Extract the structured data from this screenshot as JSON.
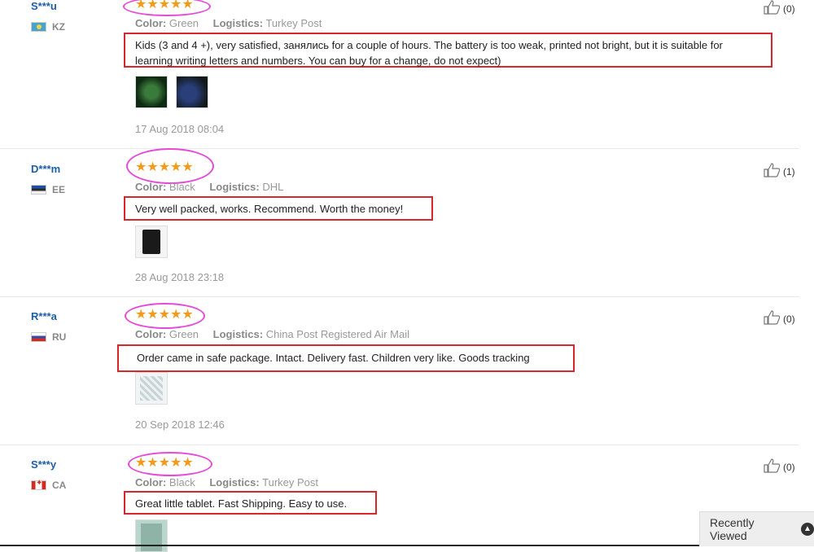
{
  "reviews": [
    {
      "user": "S***u",
      "country": "KZ",
      "flag": "kz-flag",
      "stars": "★★★★★",
      "color_label": "Color:",
      "color": "Green",
      "logistics_label": "Logistics:",
      "logistics": "Turkey Post",
      "comment": "Kids (3 and 4 +), very satisfied, занялись for a couple of hours. The battery is too weak, printed not bright, but it is suitable for learning writing letters and numbers. You can buy for a change, do not expect)",
      "date": "17 Aug 2018 08:04",
      "likes": "(0)"
    },
    {
      "user": "D***m",
      "country": "EE",
      "flag": "ee-flag",
      "stars": "★★★★★",
      "color_label": "Color:",
      "color": "Black",
      "logistics_label": "Logistics:",
      "logistics": "DHL",
      "comment": "Very well packed, works. Recommend. Worth the money!",
      "date": "28 Aug 2018 23:18",
      "likes": "(1)"
    },
    {
      "user": "R***a",
      "country": "RU",
      "flag": "ru-flag",
      "stars": "★★★★★",
      "color_label": "Color:",
      "color": "Green",
      "logistics_label": "Logistics:",
      "logistics": "China Post Registered Air Mail",
      "comment": "Order came in safe package. Intact. Delivery fast. Children very like. Goods tracking",
      "date": "20 Sep 2018 12:46",
      "likes": "(0)"
    },
    {
      "user": "S***y",
      "country": "CA",
      "flag": "ca-flag",
      "stars": "★★★★★",
      "color_label": "Color:",
      "color": "Black",
      "logistics_label": "Logistics:",
      "logistics": "Turkey Post",
      "comment": "Great little tablet. Fast Shipping. Easy to use.",
      "date": "",
      "likes": "(0)"
    }
  ],
  "recently_viewed": "Recently Viewed",
  "colors": {
    "star": "#f29a1b",
    "annotation_ellipse": "#e64ad9",
    "annotation_box": "#d9262b",
    "username": "#1b5fa8"
  }
}
